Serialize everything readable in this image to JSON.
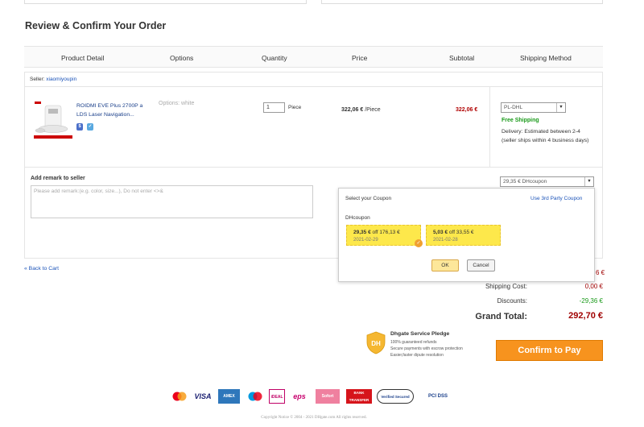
{
  "page_title": "Review & Confirm Your Order",
  "table_headers": [
    "Product Detail",
    "Options",
    "Quantity",
    "Price",
    "Subtotal",
    "Shipping Method"
  ],
  "seller": {
    "label": "Seller:",
    "name": "xiaomiyoupin"
  },
  "item": {
    "name": "ROIDMI EVE Plus 2700P a LDS Laser Navigation...",
    "options": "Options:  white",
    "quantity": "1",
    "unit": "Piece",
    "price_value": "322,06 €",
    "price_unit": "/Piece",
    "subtotal": "322,06 €",
    "shipping_method": "PL-DHL",
    "free_shipping": "Free Shipping",
    "delivery": "Delivery: Estimated between 2-4 (seller ships within 4 business days)"
  },
  "remark": {
    "label": "Add remark to seller",
    "placeholder": "Please add remark:(e.g. color, size...), Do not enter <>&"
  },
  "coupon": {
    "selected": "29,35 € DHcoupon",
    "popup_title": "Select your Coupon",
    "third_party_link": "Use 3rd Party Coupon",
    "group_label": "DHcoupon",
    "cards": [
      {
        "amount": "29,35 €",
        "condition": "off 176,13 €",
        "date": "2021-02-29",
        "selected": true
      },
      {
        "amount": "5,03 €",
        "condition": "off 33,55 €",
        "date": "2021-02-28",
        "selected": false
      }
    ],
    "ok_label": "OK",
    "cancel_label": "Cancel"
  },
  "back_link": "« Back to Cart",
  "summary": {
    "partial_amount": "6 €",
    "shipping_label": "Shipping Cost:",
    "shipping_value": "0,00 €",
    "discounts_label": "Discounts:",
    "discounts_value": "-29,36 €",
    "grand_label": "Grand Total:",
    "grand_value": "292,70 €"
  },
  "pledge": {
    "title": "Dhgate Service Pledge",
    "lines": [
      "100% guaranteed refunds",
      "Secure payments with escrow protection",
      "Easier,faster dipute resolution"
    ],
    "badge_text": "DH"
  },
  "confirm_label": "Confirm to Pay",
  "payment_logos": [
    "Mastercard",
    "VISA",
    "AMEX",
    "Maestro",
    "iDEAL",
    "eps",
    "Sofort",
    "BANK TRANSFER",
    "Verified Secured",
    "PCI DSS"
  ],
  "copyright": "Copyright Notice © 2004 - 2021 DHgate.com All rights reserved.",
  "colors": {
    "accent_orange": "#f7931e",
    "price_red": "#b00000",
    "link_blue": "#1a52b8",
    "free_green": "#1a9a1a",
    "coupon_yellow": "#fde84b"
  }
}
